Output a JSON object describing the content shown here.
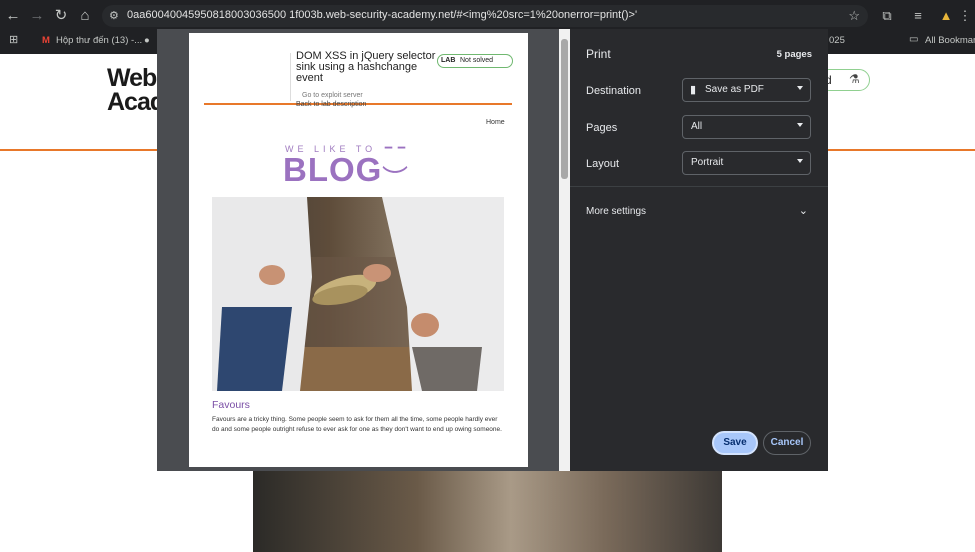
{
  "browser": {
    "url": "0aa60040045950818003036500 1f003b.web-security-academy.net/#<img%20src=1%20onerror=print()>'",
    "bookmarks": [
      {
        "label": "Hộp thư đến (13) -..."
      },
      {
        "label": "025"
      },
      {
        "label": "All Bookmarks"
      }
    ]
  },
  "background": {
    "logo_line1": "Web",
    "logo_line2": "Acad",
    "pill_text": "d"
  },
  "sheet": {
    "lab_title": "DOM XSS in jQuery selector sink using a hashchange event",
    "badge_lab": "LAB",
    "badge_status": "Not solved",
    "exploit_link": "Go to exploit server",
    "back_link": "Back to lab description",
    "home_link": "Home",
    "blog_small": "WE LIKE TO",
    "blog_big": "BLOG",
    "post_title": "Favours",
    "post_body": "Favours are a tricky thing. Some people seem to ask for them all the time, some people hardly ever do and some people outright refuse to ever ask for one as they don't want to end up owing someone."
  },
  "print": {
    "title": "Print",
    "pages_count": "5 pages",
    "destination_label": "Destination",
    "destination_value": "Save as PDF",
    "pages_label": "Pages",
    "pages_value": "All",
    "layout_label": "Layout",
    "layout_value": "Portrait",
    "more_settings": "More settings",
    "save_label": "Save",
    "cancel_label": "Cancel"
  },
  "colors": {
    "accent_orange": "#e8782a",
    "blog_purple": "#9b72c0",
    "save_blue": "#a8c7fa",
    "dialog_bg": "#292a2d"
  }
}
